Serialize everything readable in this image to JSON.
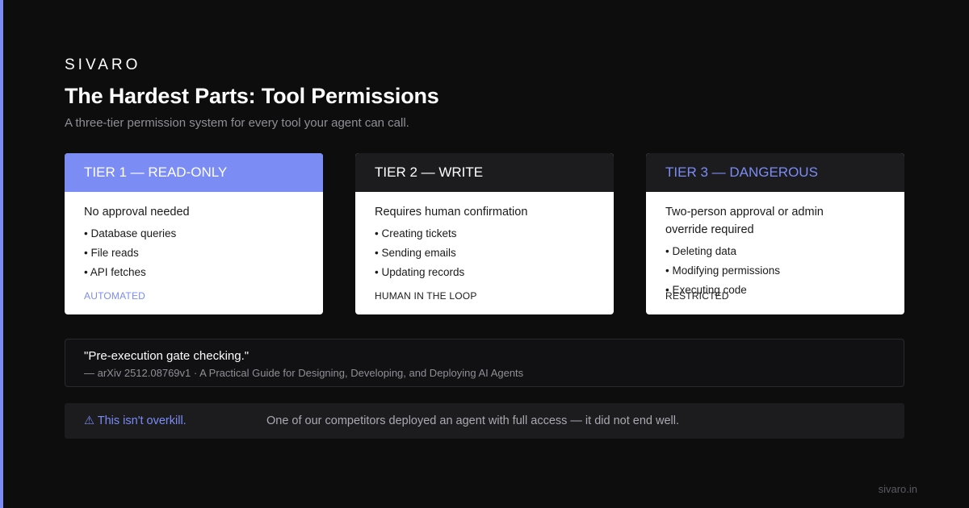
{
  "brand": "SIVARO",
  "title": "The Hardest Parts: Tool Permissions",
  "subtitle": "A three-tier permission system for every tool your agent can call.",
  "tiers": [
    {
      "heading": "TIER 1 — READ-ONLY",
      "requirement": "No approval needed",
      "items": [
        "• Database queries",
        "• File reads",
        "• API fetches"
      ],
      "tag": "AUTOMATED"
    },
    {
      "heading": "TIER 2 — WRITE",
      "requirement": "Requires human confirmation",
      "items": [
        "• Creating tickets",
        "• Sending emails",
        "• Updating records"
      ],
      "tag": "HUMAN IN THE LOOP"
    },
    {
      "heading": "TIER 3 — DANGEROUS",
      "requirement": "Two-person approval or admin override required",
      "items": [
        "• Deleting data",
        "• Modifying permissions",
        "• Executing code"
      ],
      "tag": "RESTRICTED"
    }
  ],
  "quote": {
    "text": "\"Pre-execution gate checking.\"",
    "source": "— arXiv 2512.08769v1 · A Practical Guide for Designing, Developing, and Deploying AI Agents"
  },
  "warning": {
    "title": "⚠ This isn't overkill.",
    "text": "One of our competitors deployed an agent with full access — it did not end well."
  },
  "footer": "sivaro.in",
  "colors": {
    "background": "#0d0d0d",
    "accent": "#7b8cf4",
    "card": "#ffffff",
    "card_header_dark": "#1c1c1f"
  }
}
